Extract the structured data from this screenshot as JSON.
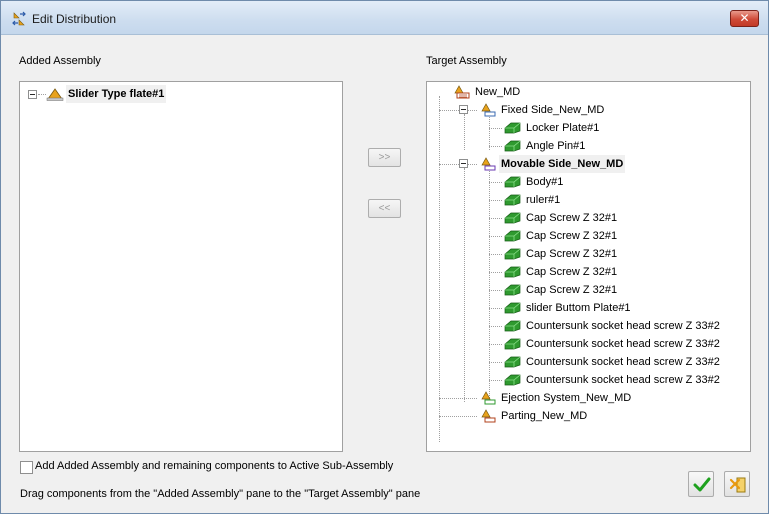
{
  "window": {
    "title": "Edit Distribution",
    "close_label": "✕"
  },
  "added": {
    "label": "Added Assembly",
    "items": [
      {
        "label": "Slider Type flate#1",
        "icon": "assembly-icon",
        "bold": true
      }
    ]
  },
  "target": {
    "label": "Target Assembly",
    "root": "New_MD",
    "fixed": "Fixed Side_New_MD",
    "fixed_children": [
      "Locker Plate#1",
      "Angle Pin#1"
    ],
    "movable": "Movable Side_New_MD",
    "movable_children": [
      "Body#1",
      "ruler#1",
      "Cap Screw Z 32#1",
      "Cap Screw Z 32#1",
      "Cap Screw Z 32#1",
      "Cap Screw Z 32#1",
      "Cap Screw Z 32#1",
      "slider Buttom Plate#1",
      "Countersunk socket head screw Z 33#2",
      "Countersunk socket head screw Z 33#2",
      "Countersunk socket head screw Z 33#2",
      "Countersunk socket head screw Z 33#2"
    ],
    "ejection": "Ejection System_New_MD",
    "parting": "Parting_New_MD"
  },
  "buttons": {
    "move_right": ">>",
    "move_left": "<<"
  },
  "footer": {
    "checkbox_label": "Add Added Assembly and remaining components to Active Sub-Assembly",
    "hint": "Drag components from the \"Added Assembly\" pane to the \"Target Assembly\" pane"
  },
  "colors": {
    "part_green": "#2f9a2f",
    "accent_orange": "#e8a21c",
    "ok_green": "#1ea11e"
  }
}
